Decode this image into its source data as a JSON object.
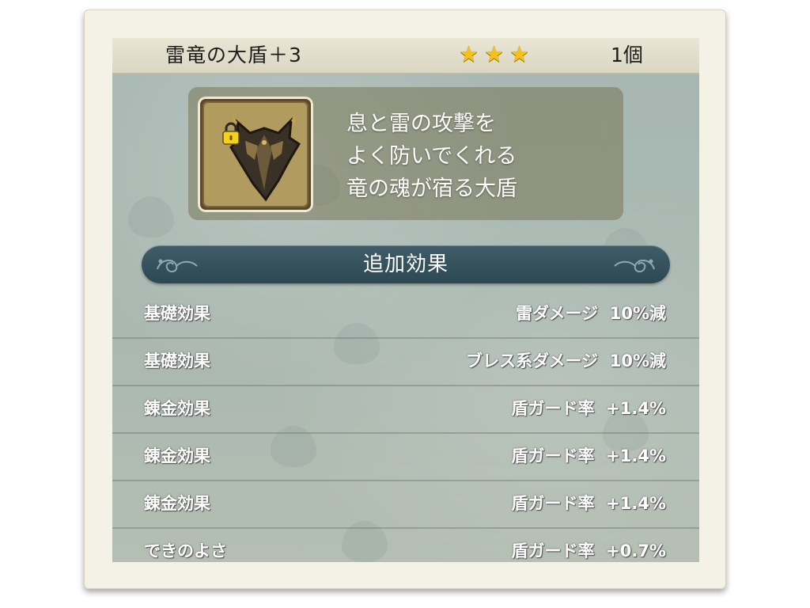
{
  "item": {
    "name": "雷竜の大盾＋3",
    "stars": [
      "★",
      "★",
      "★"
    ],
    "count": "1個",
    "icon": "dragon-shield-icon",
    "lock_icon": "lock-icon",
    "description": "息と雷の攻撃を\nよく防いでくれる\n竜の魂が宿る大盾"
  },
  "section": {
    "title": "追加効果"
  },
  "effects": [
    {
      "label": "基礎効果",
      "value": "雷ダメージ  10%減"
    },
    {
      "label": "基礎効果",
      "value": "ブレス系ダメージ  10%減"
    },
    {
      "label": "錬金効果",
      "value": "盾ガード率  +1.4%"
    },
    {
      "label": "錬金効果",
      "value": "盾ガード率  +1.4%"
    },
    {
      "label": "錬金効果",
      "value": "盾ガード率  +1.4%"
    },
    {
      "label": "できのよさ",
      "value": "盾ガード率  +0.7%"
    }
  ],
  "colors": {
    "panel": "#a9b8b3",
    "banner": "#2d4852",
    "star": "#f2c21a"
  }
}
